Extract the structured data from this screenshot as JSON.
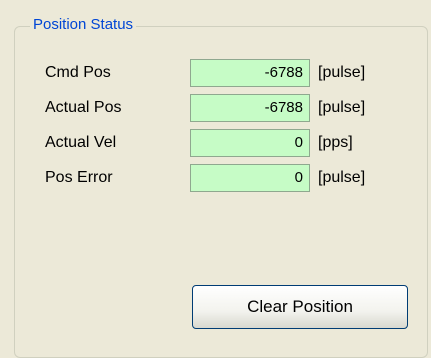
{
  "group": {
    "title": "Position Status"
  },
  "rows": [
    {
      "label": "Cmd Pos",
      "value": "-6788",
      "unit": "[pulse]"
    },
    {
      "label": "Actual Pos",
      "value": "-6788",
      "unit": "[pulse]"
    },
    {
      "label": "Actual Vel",
      "value": "0",
      "unit": "[pps]"
    },
    {
      "label": "Pos Error",
      "value": "0",
      "unit": "[pulse]"
    }
  ],
  "buttons": {
    "clear_position": "Clear Position"
  },
  "colors": {
    "value_field_bg": "#c6fcc6",
    "group_title": "#0046d5",
    "panel_bg": "#ece9d8"
  }
}
